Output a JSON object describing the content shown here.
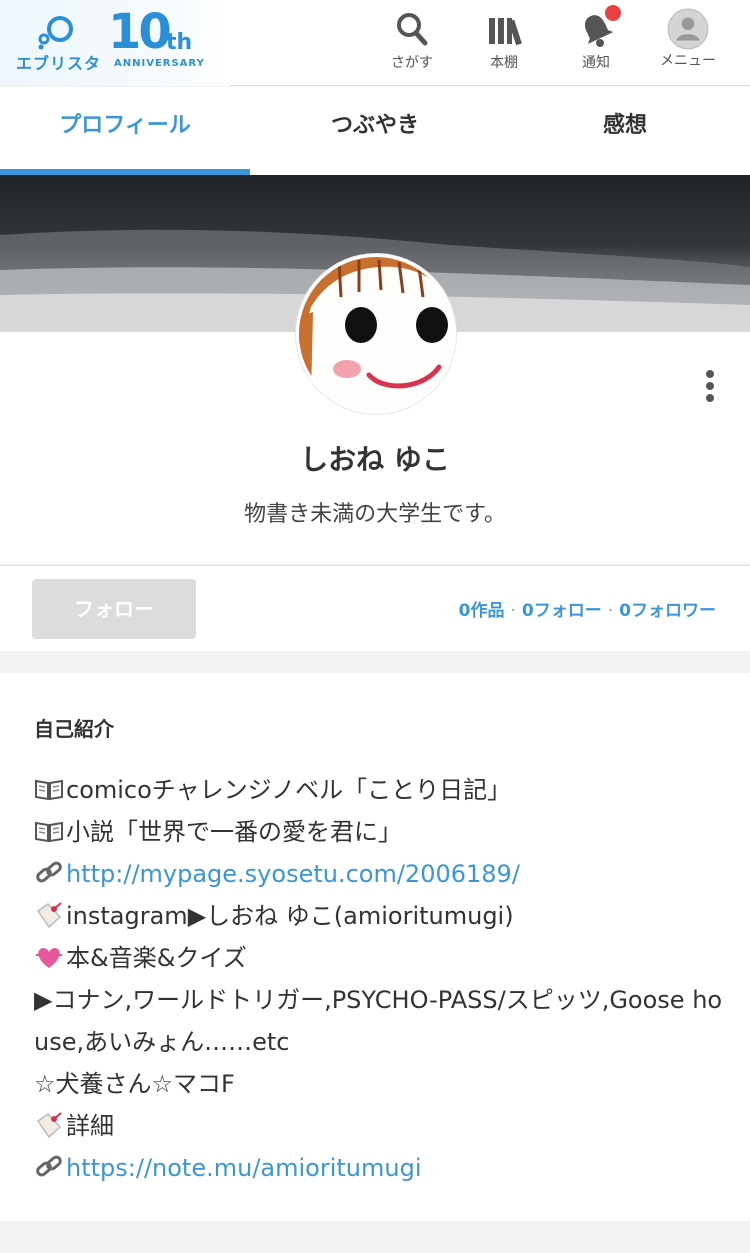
{
  "header": {
    "logo_text": "エブリスタ",
    "logo_number": "10",
    "logo_suffix": "th",
    "logo_anniversary": "ANNIVERSARY",
    "nav": [
      {
        "label": "さがす",
        "icon": "search-icon"
      },
      {
        "label": "本棚",
        "icon": "bookshelf-icon"
      },
      {
        "label": "通知",
        "icon": "bell-icon"
      },
      {
        "label": "メニュー",
        "icon": "user-avatar-icon"
      }
    ],
    "has_notification": true
  },
  "tabs": [
    {
      "label": "プロフィール",
      "active": true
    },
    {
      "label": "つぶやき",
      "active": false
    },
    {
      "label": "感想",
      "active": false
    }
  ],
  "profile": {
    "name": "しおね ゆこ",
    "tagline": "物書き未満の大学生です。"
  },
  "follow": {
    "button_label": "フォロー",
    "works": "0作品",
    "following": "0フォロー",
    "followers": "0フォロワー",
    "separator": "·"
  },
  "intro": {
    "title": "自己紹介",
    "lines": [
      {
        "icon": "open-book-icon",
        "text": "comicoチャレンジノベル「ことり日記」",
        "link": false
      },
      {
        "icon": "open-book-icon",
        "text": "小説「世界で一番の愛を君に」",
        "link": false
      },
      {
        "icon": "link-icon",
        "text": "http://mypage.syosetu.com/2006189/",
        "link": true
      },
      {
        "icon": "tag-icon",
        "text": "instagram▶しおね ゆこ(amioritumugi)",
        "link": false
      },
      {
        "icon": "heart-icon",
        "text": "本&音楽&クイズ",
        "link": false
      },
      {
        "icon": "",
        "text": "▶コナン,ワールドトリガー,PSYCHO-PASS/スピッツ,Goose house,あいみょん……etc",
        "link": false
      },
      {
        "icon": "",
        "text": "☆犬養さん☆マコF",
        "link": false
      },
      {
        "icon": "tag-icon",
        "text": "詳細",
        "link": false
      },
      {
        "icon": "link-icon",
        "text": "https://note.mu/amioritumugi",
        "link": true
      }
    ]
  },
  "colors": {
    "accent": "#3a96d8",
    "notification": "#e84141",
    "button_disabled": "#dcdcdc"
  }
}
